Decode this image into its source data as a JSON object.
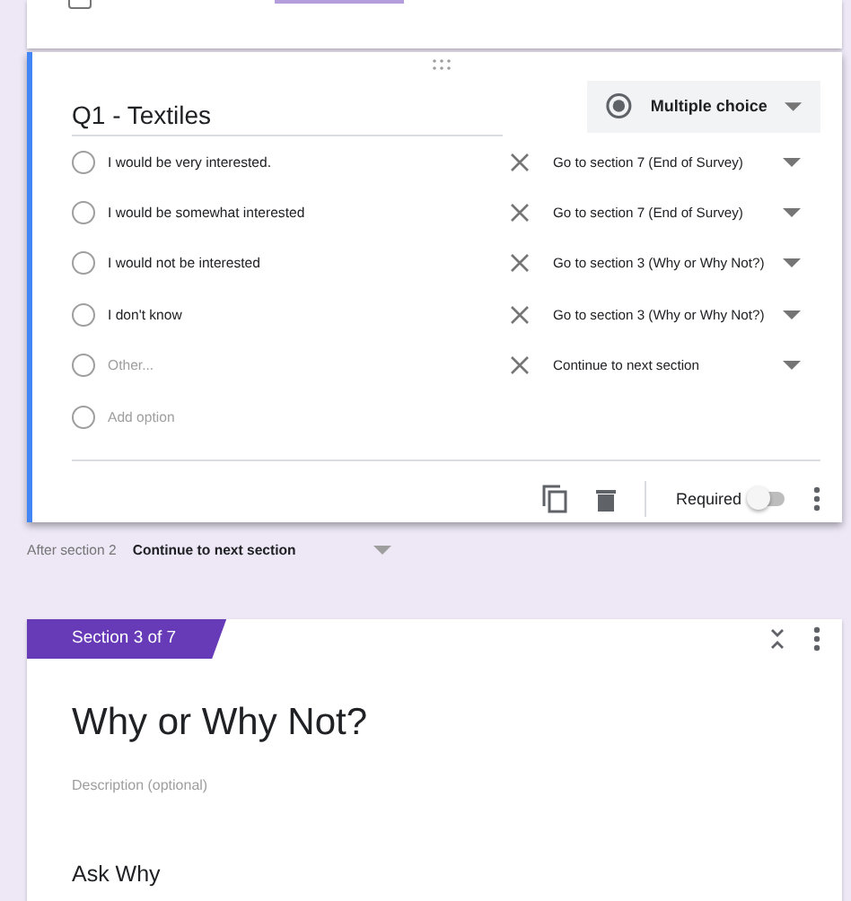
{
  "top_checkbox": {
    "checked": false
  },
  "question": {
    "title": "Q1 - Textiles",
    "type": "Multiple choice",
    "options": [
      {
        "kind": "option",
        "label": "I would be very interested.",
        "checked": false,
        "goto": "Go to section 7 (End of Survey)"
      },
      {
        "kind": "option",
        "label": "I would be somewhat interested",
        "checked": false,
        "goto": "Go to section 7 (End of Survey)"
      },
      {
        "kind": "option",
        "label": "I would not be interested",
        "checked": false,
        "goto": "Go to section 3 (Why or Why Not?)"
      },
      {
        "kind": "option",
        "label": "I don't know",
        "checked": false,
        "goto": "Go to section 3 (Why or Why Not?)"
      },
      {
        "kind": "other",
        "label": "Other...",
        "checked": false,
        "goto": "Continue to next section"
      },
      {
        "kind": "add",
        "label": "Add option",
        "checked": false
      }
    ],
    "required_label": "Required",
    "required": false
  },
  "after_section": {
    "label": "After section 2",
    "value": "Continue to next section"
  },
  "section": {
    "badge": "Section 3 of 7",
    "title": "Why or Why Not?",
    "description_placeholder": "Description (optional)",
    "next_question": "Ask Why"
  }
}
